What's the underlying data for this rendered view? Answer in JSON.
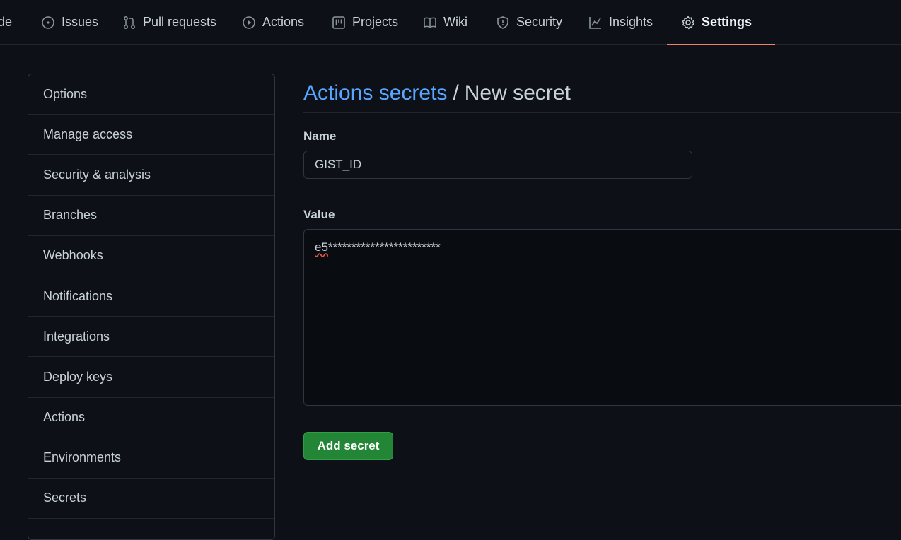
{
  "topnav": {
    "tabs": [
      {
        "label": "de",
        "icon": "code-icon"
      },
      {
        "label": "Issues",
        "icon": "issue-opened-icon"
      },
      {
        "label": "Pull requests",
        "icon": "git-pull-request-icon"
      },
      {
        "label": "Actions",
        "icon": "play-icon"
      },
      {
        "label": "Projects",
        "icon": "project-icon"
      },
      {
        "label": "Wiki",
        "icon": "book-icon"
      },
      {
        "label": "Security",
        "icon": "shield-icon"
      },
      {
        "label": "Insights",
        "icon": "graph-icon"
      },
      {
        "label": "Settings",
        "icon": "gear-icon",
        "active": true
      }
    ]
  },
  "sidebar": {
    "items": [
      {
        "label": "Options"
      },
      {
        "label": "Manage access"
      },
      {
        "label": "Security & analysis"
      },
      {
        "label": "Branches"
      },
      {
        "label": "Webhooks"
      },
      {
        "label": "Notifications"
      },
      {
        "label": "Integrations"
      },
      {
        "label": "Deploy keys"
      },
      {
        "label": "Actions"
      },
      {
        "label": "Environments"
      },
      {
        "label": "Secrets"
      }
    ]
  },
  "main": {
    "title_link": "Actions secrets",
    "title_separator": "/",
    "title_rest": "New secret",
    "name_label": "Name",
    "name_value": "GIST_ID",
    "value_label": "Value",
    "value_prefix": "e5",
    "value_masked": "************************",
    "submit_label": "Add secret"
  },
  "colors": {
    "background": "#0d1117",
    "link": "#58a6ff",
    "accent_underline": "#f78166",
    "button_green": "#238636"
  }
}
